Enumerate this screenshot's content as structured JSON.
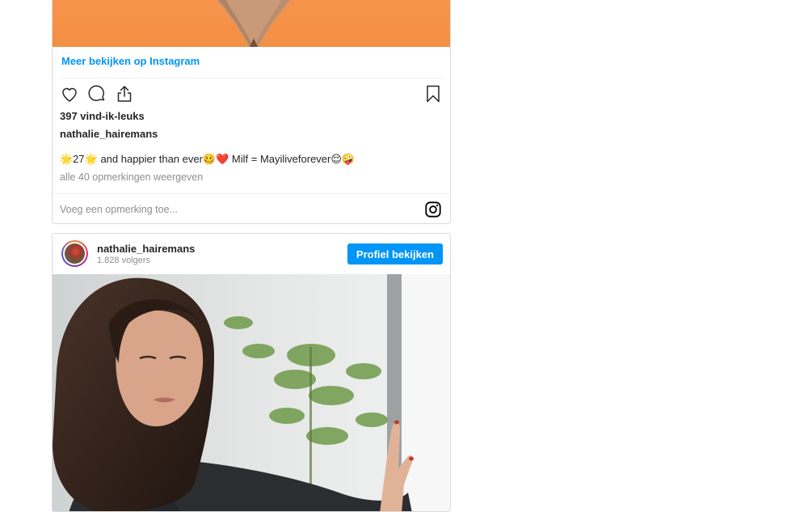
{
  "post1": {
    "see_more_label": "Meer bekijken op Instagram",
    "likes": "397 vind-ik-leuks",
    "username": "nathalie_hairemans",
    "caption": "🌟27🌟 and happier than ever🥴❤️ Milf = Mayiliveforever😌🤪",
    "view_comments": "alle 40 opmerkingen weergeven",
    "comment_placeholder": "Voeg een opmerking toe..."
  },
  "post2": {
    "username": "nathalie_hairemans",
    "followers": "1.828 volgers",
    "profile_button": "Profiel bekijken"
  },
  "icons": [
    "heart-icon",
    "comment-icon",
    "share-icon",
    "bookmark-icon",
    "instagram-logo-icon"
  ],
  "colors": {
    "accent": "#0095f6",
    "muted": "#8e8e8e",
    "border": "#dbdbdb",
    "photo_bg": "#f38f43"
  }
}
